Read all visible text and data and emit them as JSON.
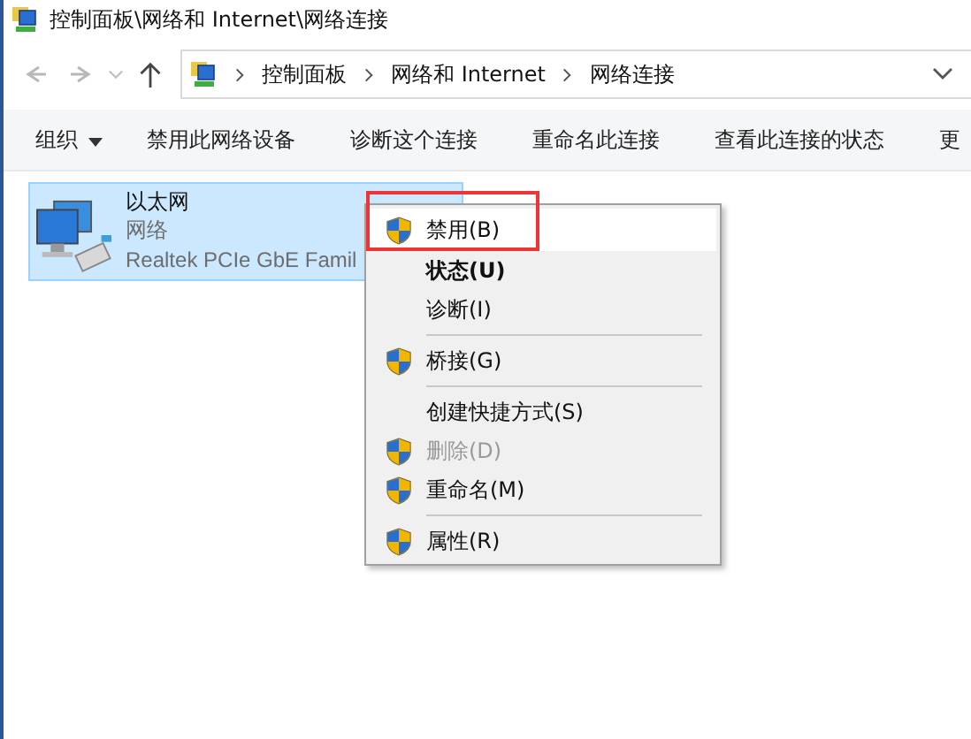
{
  "window": {
    "title": "控制面板\\网络和 Internet\\网络连接"
  },
  "address_bar": {
    "crumbs": [
      "控制面板",
      "网络和 Internet",
      "网络连接"
    ]
  },
  "toolbar": {
    "items": [
      {
        "label": "组织",
        "dropdown": true
      },
      {
        "label": "禁用此网络设备",
        "dropdown": false
      },
      {
        "label": "诊断这个连接",
        "dropdown": false
      },
      {
        "label": "重命名此连接",
        "dropdown": false
      },
      {
        "label": "查看此连接的状态",
        "dropdown": false
      },
      {
        "label": "更",
        "dropdown": false
      }
    ]
  },
  "connections": [
    {
      "name": "以太网",
      "network": "网络",
      "device": "Realtek PCIe GbE Famil",
      "selected": true
    }
  ],
  "context_menu": {
    "items": [
      {
        "kind": "item",
        "label": "禁用(B)",
        "shield": true,
        "bold": false,
        "disabled": false,
        "selected": true,
        "annotated": true
      },
      {
        "kind": "item",
        "label": "状态(U)",
        "shield": false,
        "bold": true,
        "disabled": false,
        "selected": false,
        "annotated": false
      },
      {
        "kind": "item",
        "label": "诊断(I)",
        "shield": false,
        "bold": false,
        "disabled": false,
        "selected": false,
        "annotated": false
      },
      {
        "kind": "separator"
      },
      {
        "kind": "item",
        "label": "桥接(G)",
        "shield": true,
        "bold": false,
        "disabled": false,
        "selected": false,
        "annotated": false
      },
      {
        "kind": "separator"
      },
      {
        "kind": "item",
        "label": "创建快捷方式(S)",
        "shield": false,
        "bold": false,
        "disabled": false,
        "selected": false,
        "annotated": false
      },
      {
        "kind": "item",
        "label": "删除(D)",
        "shield": true,
        "bold": false,
        "disabled": true,
        "selected": false,
        "annotated": false
      },
      {
        "kind": "item",
        "label": "重命名(M)",
        "shield": true,
        "bold": false,
        "disabled": false,
        "selected": false,
        "annotated": false
      },
      {
        "kind": "separator"
      },
      {
        "kind": "item",
        "label": "属性(R)",
        "shield": true,
        "bold": false,
        "disabled": false,
        "selected": false,
        "annotated": false
      }
    ]
  }
}
